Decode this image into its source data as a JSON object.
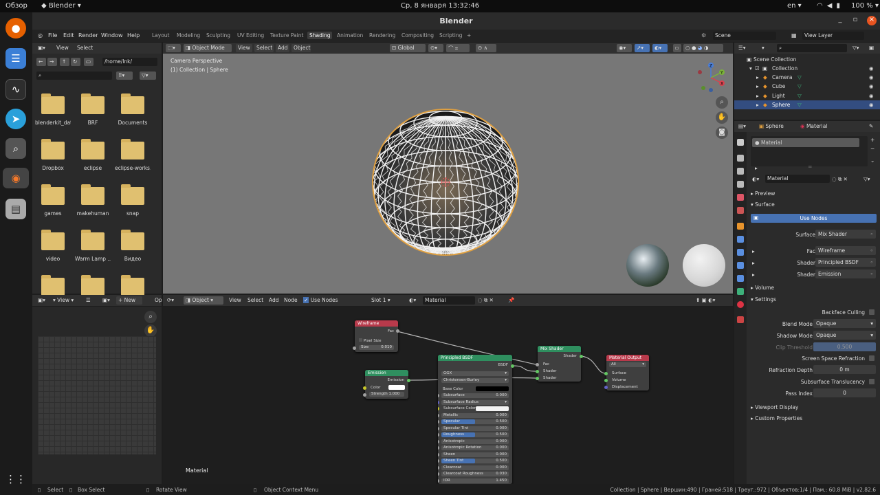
{
  "os": {
    "overview": "Обзор",
    "app": "Blender ▾",
    "clock": "Ср, 8 января 13:32:46",
    "lang": "en ▾",
    "battery": "100 % ▾"
  },
  "window": {
    "title": "Blender"
  },
  "menu": [
    "File",
    "Edit",
    "Render",
    "Window",
    "Help"
  ],
  "workspaces": [
    "Layout",
    "Modeling",
    "Sculpting",
    "UV Editing",
    "Texture Paint",
    "Shading",
    "Animation",
    "Rendering",
    "Compositing",
    "Scripting"
  ],
  "active_workspace": "Shading",
  "scene": {
    "name": "Scene",
    "view_layer": "View Layer"
  },
  "file_browser": {
    "header": [
      "View",
      "Select"
    ],
    "path": "/home/lnk/",
    "folders": [
      "blenderkit_dat",
      "BRF",
      "Documents",
      "Dropbox",
      "eclipse",
      "eclipse-works...",
      "games",
      "makehuman",
      "snap",
      "video",
      "Warm Lamp ...",
      "Видео",
      "",
      "",
      ""
    ]
  },
  "viewport": {
    "mode": "Object Mode",
    "menus": [
      "View",
      "Select",
      "Add",
      "Object"
    ],
    "orientation": "Global",
    "info_line1": "Camera Perspective",
    "info_line2": "(1) Collection | Sphere",
    "axes": {
      "x": "X",
      "y": "Y",
      "z": "Z"
    }
  },
  "image_editor": {
    "view": "View",
    "new": "New",
    "open": "Op"
  },
  "node_editor": {
    "object": "Object",
    "menus": [
      "View",
      "Select",
      "Add",
      "Node"
    ],
    "use_nodes": "Use Nodes",
    "slot": "Slot 1",
    "material": "Material",
    "footer_label": "Material",
    "nodes": {
      "wireframe": {
        "title": "Wireframe",
        "fac": "Fac",
        "pixel_size": "Pixel Size",
        "size_label": "Size",
        "size_value": "0.010"
      },
      "emission": {
        "title": "Emission",
        "out": "Emission",
        "color": "Color",
        "strength": "Strength",
        "strength_value": "1.000"
      },
      "bsdf": {
        "title": "Principled BSDF",
        "out": "BSDF",
        "dist": "GGX",
        "sss": "Christensen-Burley",
        "base_color": "Base Color",
        "rows": [
          {
            "label": "Subsurface",
            "value": "0.000"
          },
          {
            "label": "Subsurface Radius",
            "value": ""
          },
          {
            "label": "Subsurface Color",
            "value": ""
          },
          {
            "label": "Metallic",
            "value": "0.000"
          },
          {
            "label": "Specular",
            "value": "0.500"
          },
          {
            "label": "Specular Tint",
            "value": "0.000"
          },
          {
            "label": "Roughness",
            "value": "0.500"
          },
          {
            "label": "Anisotropic",
            "value": "0.000"
          },
          {
            "label": "Anisotropic Rotation",
            "value": "0.000"
          },
          {
            "label": "Sheen",
            "value": "0.000"
          },
          {
            "label": "Sheen Tint",
            "value": "0.500"
          },
          {
            "label": "Clearcoat",
            "value": "0.000"
          },
          {
            "label": "Clearcoat Roughness",
            "value": "0.030"
          },
          {
            "label": "IOR",
            "value": "1.450"
          }
        ]
      },
      "mix": {
        "title": "Mix Shader",
        "out": "Shader",
        "fac": "Fac",
        "s1": "Shader",
        "s2": "Shader"
      },
      "output": {
        "title": "Material Output",
        "target": "All",
        "surface": "Surface",
        "volume": "Volume",
        "displacement": "Displacement"
      }
    }
  },
  "outliner": {
    "root": "Scene Collection",
    "collection": "Collection",
    "items": [
      "Camera",
      "Cube",
      "Light",
      "Sphere"
    ],
    "selected": "Sphere"
  },
  "properties": {
    "object": "Sphere",
    "material_tab": "Material",
    "slot_item": "Material",
    "material_name": "Material",
    "preview": "Preview",
    "surface_section": "Surface",
    "use_nodes": "Use Nodes",
    "surface": {
      "label": "Surface",
      "value": "Mix Shader"
    },
    "fac": {
      "label": "Fac",
      "value": "Wireframe"
    },
    "shader1": {
      "label": "Shader",
      "value": "Principled BSDF"
    },
    "shader2": {
      "label": "Shader",
      "value": "Emission"
    },
    "volume": "Volume",
    "settings": "Settings",
    "backface": "Backface Culling",
    "blend_mode": {
      "label": "Blend Mode",
      "value": "Opaque"
    },
    "shadow_mode": {
      "label": "Shadow Mode",
      "value": "Opaque"
    },
    "clip": {
      "label": "Clip Threshold",
      "value": "0.500"
    },
    "ssr": "Screen Space Refraction",
    "refraction_depth": {
      "label": "Refraction Depth",
      "value": "0 m"
    },
    "sss_trans": "Subsurface Translucency",
    "pass_index": {
      "label": "Pass Index",
      "value": "0"
    },
    "viewport_display": "Viewport Display",
    "custom_props": "Custom Properties"
  },
  "status": {
    "select": "Select",
    "box_select": "Box Select",
    "rotate": "Rotate View",
    "context": "Object Context Menu",
    "stats": "Collection | Sphere | Вершин:490 | Граней:518 | Треуг.:972 | Объектов:1/4 | Пам.: 60.8 MiB | v2.82.6"
  },
  "colors": {
    "wireframe_header": "#b83a4b",
    "emission_header": "#2f8f5f",
    "bsdf_header": "#2f8f5f",
    "mix_header": "#2f8f5f",
    "output_header": "#b83a4b",
    "selection": "#e0a040",
    "accent": "#4772b3"
  }
}
